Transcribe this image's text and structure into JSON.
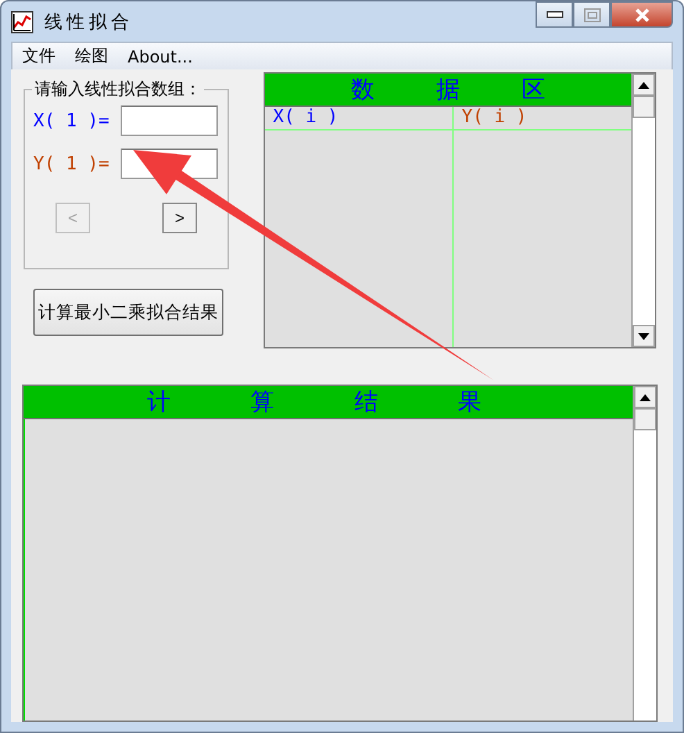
{
  "window": {
    "title": "线性拟合"
  },
  "menu": [
    "文件",
    "绘图",
    "About..."
  ],
  "input_group": {
    "label": "请输入线性拟合数组：",
    "fields": [
      {
        "label": "X( 1 )=",
        "color": "#0000ff"
      },
      {
        "label": "Y( 1 )=",
        "color": "#c04000"
      }
    ],
    "prev_button": {
      "label": "<",
      "disabled": true
    },
    "next_button": {
      "label": ">",
      "disabled": false
    }
  },
  "compute_button": "计算最小二乘拟合结果",
  "data_area": {
    "header": [
      "数",
      "据",
      "区"
    ],
    "columns": [
      {
        "label": "X( i )",
        "color": "#0000ff"
      },
      {
        "label": "Y( i )",
        "color": "#c04000"
      }
    ]
  },
  "result_area": {
    "header": [
      "计",
      "算",
      "结",
      "果"
    ]
  }
}
